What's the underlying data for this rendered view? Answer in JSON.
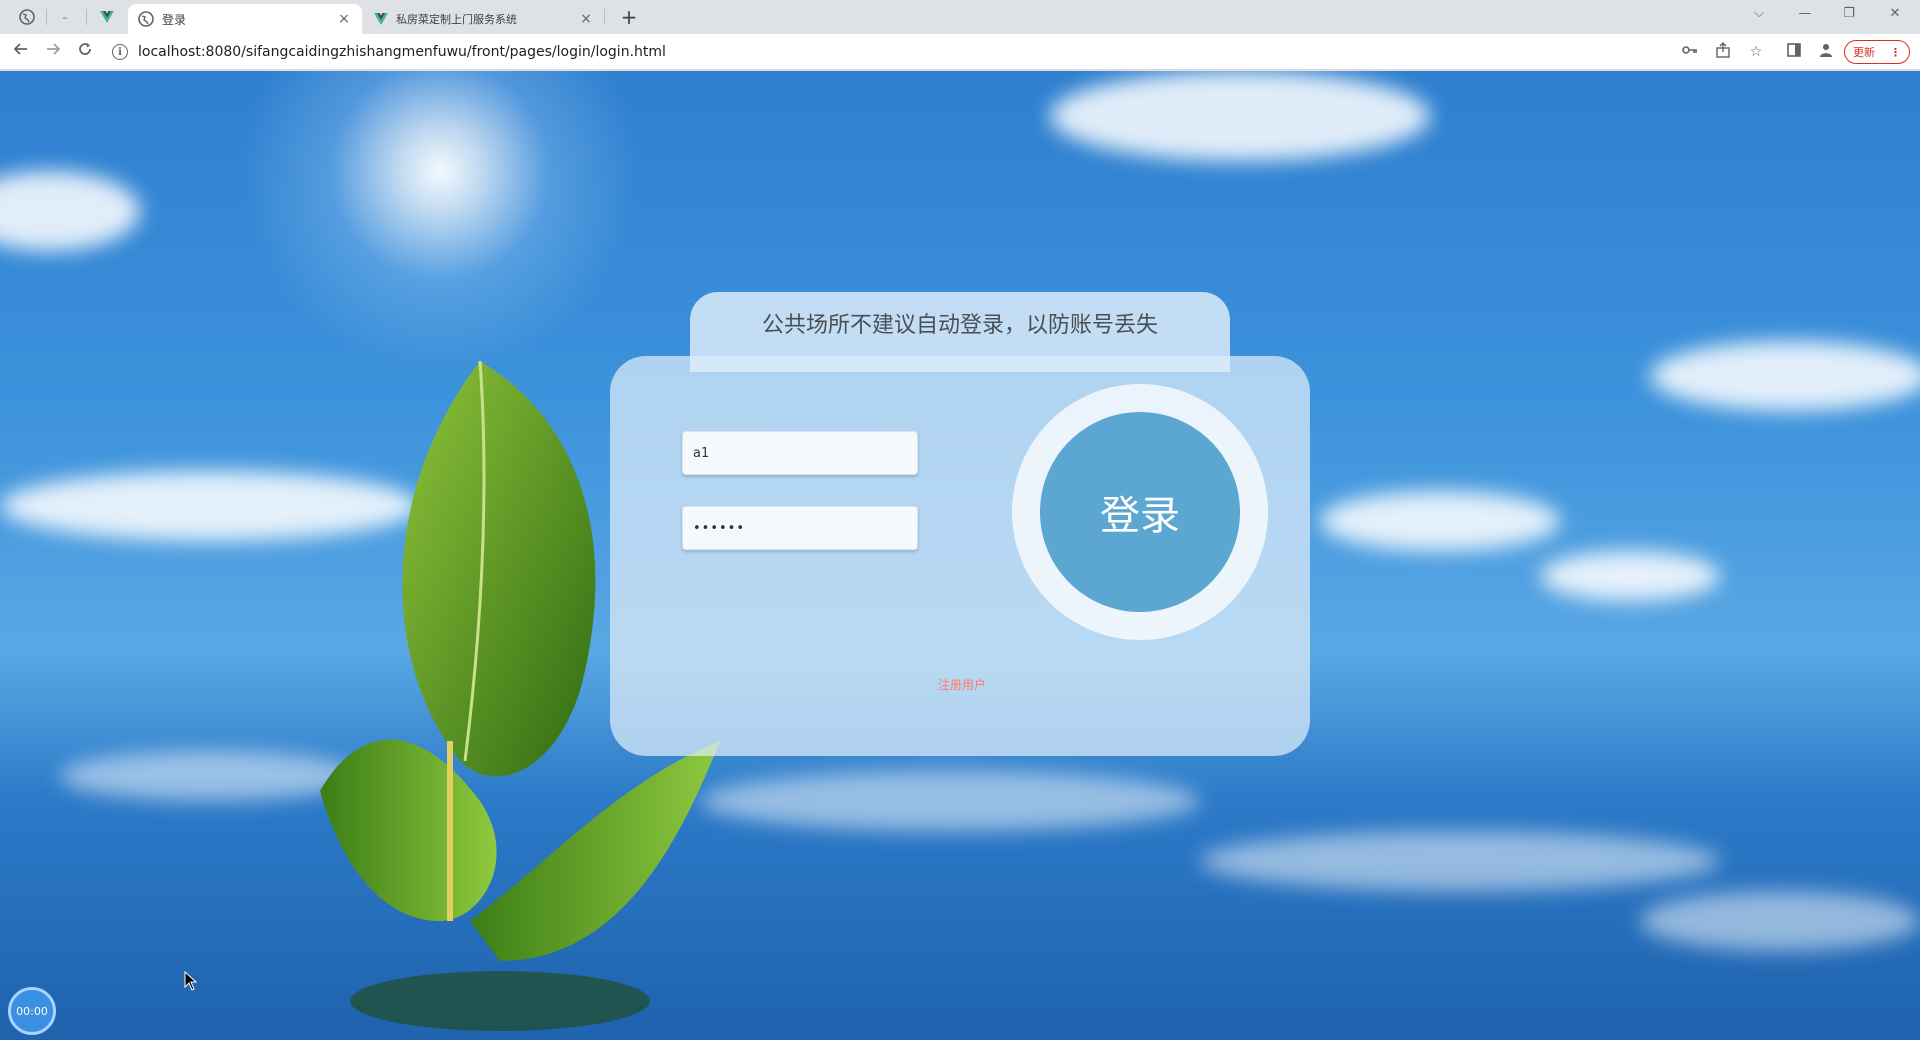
{
  "tabs": [
    {
      "label": "登录",
      "active": true
    },
    {
      "label": "私房菜定制上门服务系统",
      "active": false
    }
  ],
  "window_controls": {
    "chevron": "⌵",
    "minimize": "—",
    "restore": "❐",
    "close": "✕"
  },
  "address_bar": {
    "url": "localhost:8080/sifangcaidingzhishangmenfuwu/front/pages/login/login.html"
  },
  "update_button": {
    "label": "更新"
  },
  "login": {
    "notice": "公共场所不建议自动登录，以防账号丢失",
    "username_value": "a1",
    "password_value": "••••••",
    "login_button_label": "登录",
    "register_link_label": "注册用户"
  },
  "timer": {
    "label": "00:00"
  },
  "colors": {
    "accent": "#5ba7d1",
    "register_link": "#ff7a6b",
    "sky": "#3d93dc"
  }
}
